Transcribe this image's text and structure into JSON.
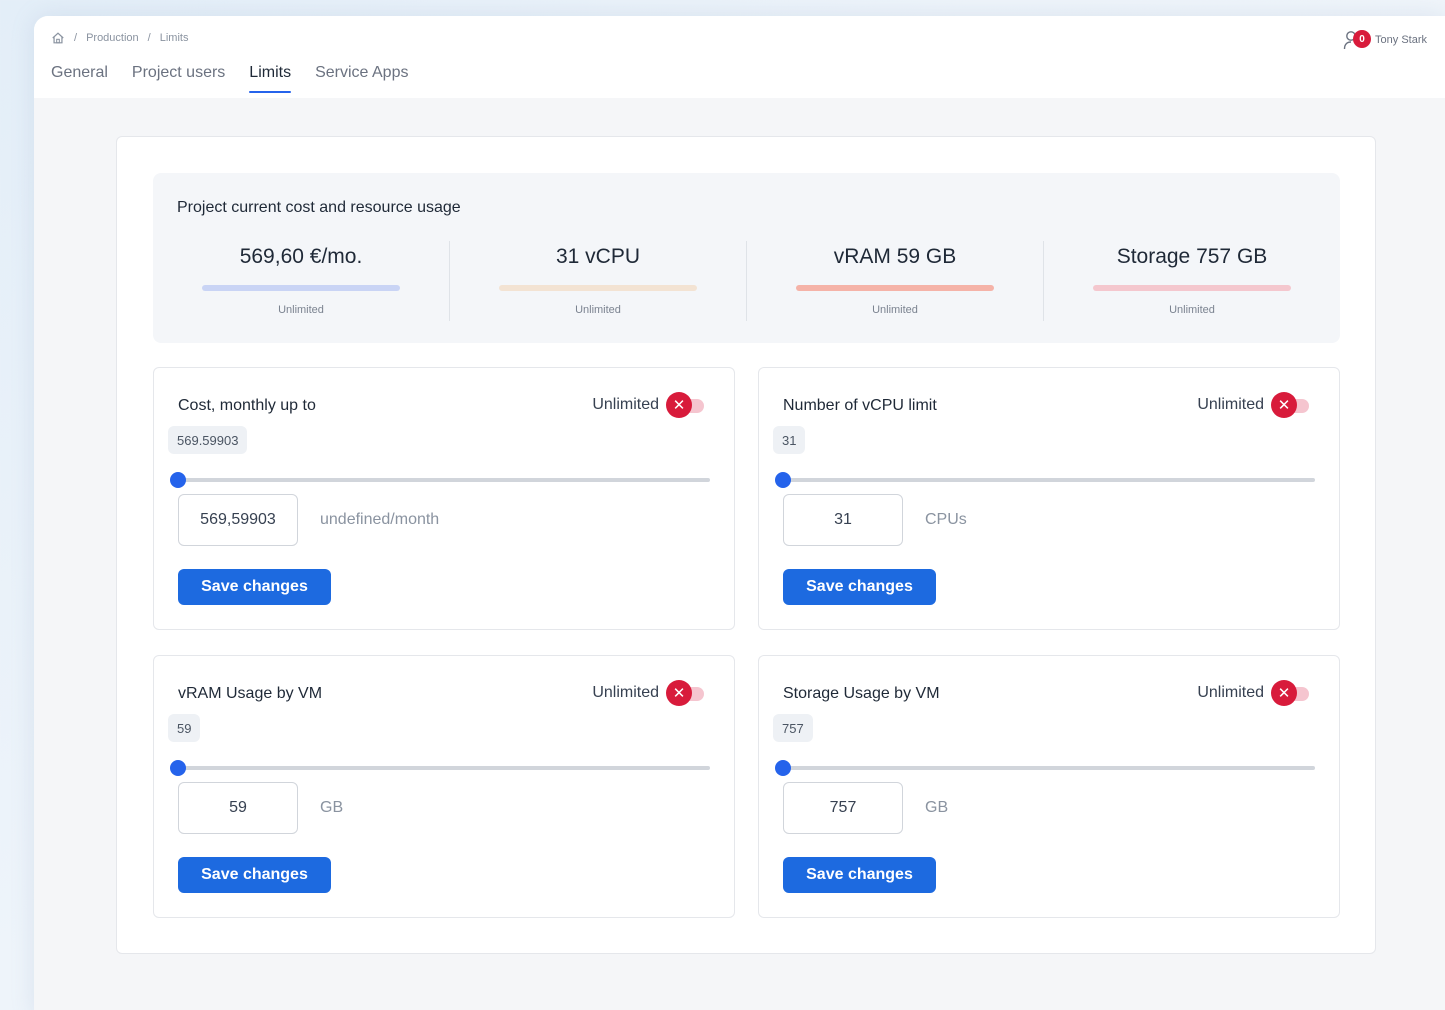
{
  "breadcrumb": {
    "home_icon": "home-icon",
    "items": [
      "Production",
      "Limits"
    ]
  },
  "tabs": [
    {
      "label": "General",
      "active": false
    },
    {
      "label": "Project users",
      "active": false
    },
    {
      "label": "Limits",
      "active": true
    },
    {
      "label": "Service Apps",
      "active": false
    }
  ],
  "user": {
    "icon": "user-icon",
    "notification_count": "0",
    "name": "Tony Stark"
  },
  "usage": {
    "title": "Project current cost and resource usage",
    "items": [
      {
        "value": "569,60 €/mo.",
        "limit": "Unlimited",
        "color": "#c9d4f5"
      },
      {
        "value": "31 vCPU",
        "limit": "Unlimited",
        "color": "#f3e3d3"
      },
      {
        "value": "vRAM 59 GB",
        "limit": "Unlimited",
        "color": "#f5b3a8"
      },
      {
        "value": "Storage 757 GB",
        "limit": "Unlimited",
        "color": "#f4c7ce"
      }
    ]
  },
  "limits": [
    {
      "title": "Cost, monthly up to",
      "unlimited_label": "Unlimited",
      "chip": "569.59903",
      "input_value": "569,59903",
      "unit": "undefined/month",
      "save_label": "Save changes"
    },
    {
      "title": "Number of vCPU limit",
      "unlimited_label": "Unlimited",
      "chip": "31",
      "input_value": "31",
      "unit": "CPUs",
      "save_label": "Save changes"
    },
    {
      "title": "vRAM Usage by VM",
      "unlimited_label": "Unlimited",
      "chip": "59",
      "input_value": "59",
      "unit": "GB",
      "save_label": "Save changes"
    },
    {
      "title": "Storage Usage by VM",
      "unlimited_label": "Unlimited",
      "chip": "757",
      "input_value": "757",
      "unit": "GB",
      "save_label": "Save changes"
    }
  ],
  "colors": {
    "accent": "#1d6ae0",
    "danger": "#d81b3b"
  },
  "toggle_icon": "close-icon"
}
